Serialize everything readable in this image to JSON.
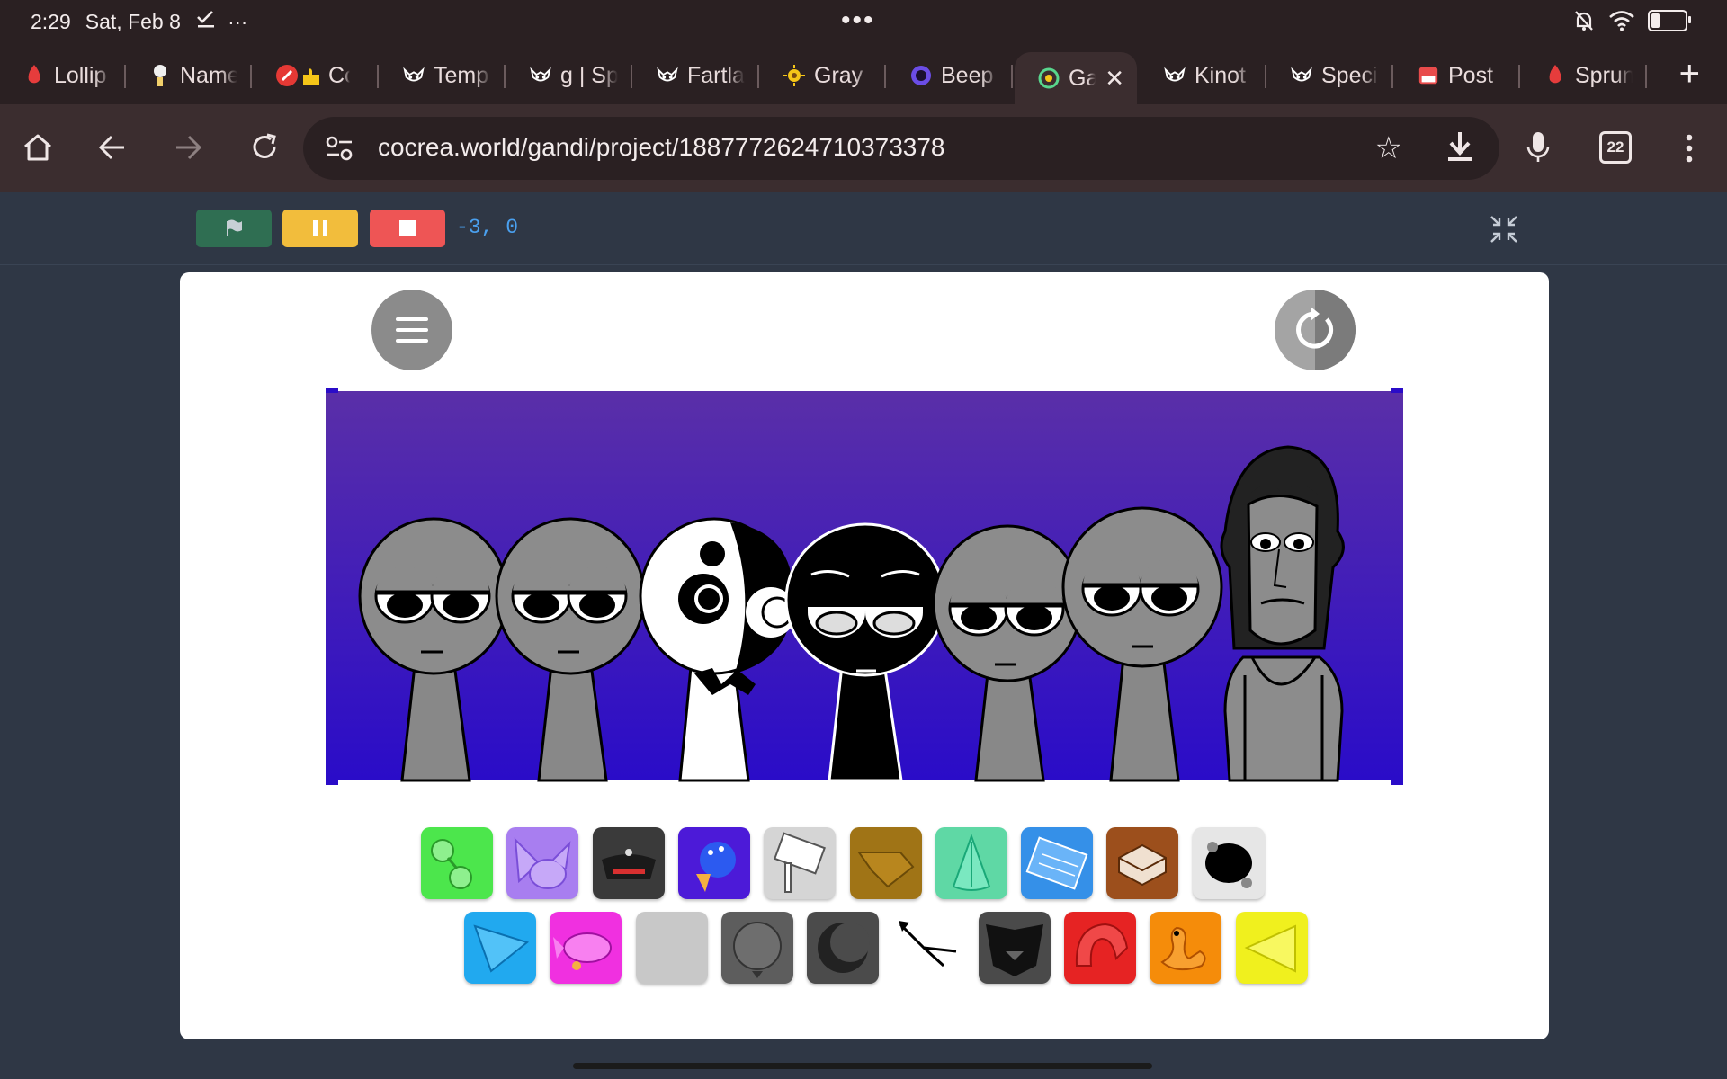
{
  "status_bar": {
    "time": "2:29",
    "date": "Sat, Feb 8",
    "extra_icons": "✓̲  ···",
    "center_dots": "•••",
    "battery_level": "6"
  },
  "tabs": [
    {
      "label": "Lollip",
      "icon": "fire-icon",
      "color": "#e63c3c"
    },
    {
      "label": "Name",
      "icon": "person-icon",
      "color": "#f2d06b"
    },
    {
      "label": "Cc",
      "icon": "pencil-thumb-icon",
      "color": "#e53935"
    },
    {
      "label": "Temp",
      "icon": "mask-icon",
      "color": "#ffffff"
    },
    {
      "label": "g | Sp",
      "icon": "mask-icon",
      "color": "#ffffff"
    },
    {
      "label": "Fartla",
      "icon": "mask-icon",
      "color": "#ffffff"
    },
    {
      "label": "Gray",
      "icon": "sun-icon",
      "color": "#f5c518"
    },
    {
      "label": "Beep",
      "icon": "ring-icon",
      "color": "#6b4de6"
    },
    {
      "label": "Ga",
      "icon": "target-icon",
      "color": "#58d68d",
      "active": true
    },
    {
      "label": "Kinot",
      "icon": "mask-icon",
      "color": "#ffffff"
    },
    {
      "label": "Speci",
      "icon": "mask-icon",
      "color": "#ffffff"
    },
    {
      "label": "Post",
      "icon": "store-icon",
      "color": "#e84b4b"
    },
    {
      "label": "Sprun",
      "icon": "fire-icon",
      "color": "#e63c3c"
    }
  ],
  "address_bar": {
    "url": "cocrea.world/gandi/project/1887772624710373378",
    "tab_count": "22"
  },
  "project_controls": {
    "coords": "-3, 0"
  },
  "scene": {
    "background_top": "#5a2fa8",
    "background_bottom": "#2a0cc8",
    "characters": [
      "gray-sprunki-1",
      "gray-sprunki-2",
      "panda-sprunki",
      "black-sprunki",
      "gray-sprunki-3",
      "gray-sprunki-4",
      "long-hair-sprunki"
    ]
  },
  "palette": {
    "row1": [
      {
        "name": "green-bubbles-icon",
        "bg": "#4ce64c"
      },
      {
        "name": "purple-cat-ears-icon",
        "bg": "#a87ef0"
      },
      {
        "name": "dark-boombox-icon",
        "bg": "#3a3a3a"
      },
      {
        "name": "blue-ice-cream-icon",
        "bg": "#4c1ad8"
      },
      {
        "name": "sign-hammer-icon",
        "bg": "#d5d5d5"
      },
      {
        "name": "brown-wing-icon",
        "bg": "#a07416"
      },
      {
        "name": "teal-leaf-icon",
        "bg": "#5fd8a5"
      },
      {
        "name": "blue-keyboard-icon",
        "bg": "#3590e8"
      },
      {
        "name": "brown-box-icon",
        "bg": "#9c4f1c"
      },
      {
        "name": "black-blob-icon",
        "bg": "#e6e6e6"
      }
    ],
    "row2": [
      {
        "name": "blue-triangle-icon",
        "bg": "#21a9ef"
      },
      {
        "name": "pink-fish-icon",
        "bg": "#f030e0"
      },
      {
        "name": "gray-blank-icon",
        "bg": "#c8c8c8"
      },
      {
        "name": "gray-ball-icon",
        "bg": "#5d5d5d"
      },
      {
        "name": "dark-moon-icon",
        "bg": "#4b4b4b"
      },
      {
        "name": "black-arrow-icon",
        "bg": "#ffffff"
      },
      {
        "name": "black-bat-icon",
        "bg": "#4a4a4a"
      },
      {
        "name": "red-hook-icon",
        "bg": "#e62323"
      },
      {
        "name": "orange-duck-icon",
        "bg": "#f58c0a"
      },
      {
        "name": "yellow-triangle-icon",
        "bg": "#f0f01e"
      }
    ]
  }
}
